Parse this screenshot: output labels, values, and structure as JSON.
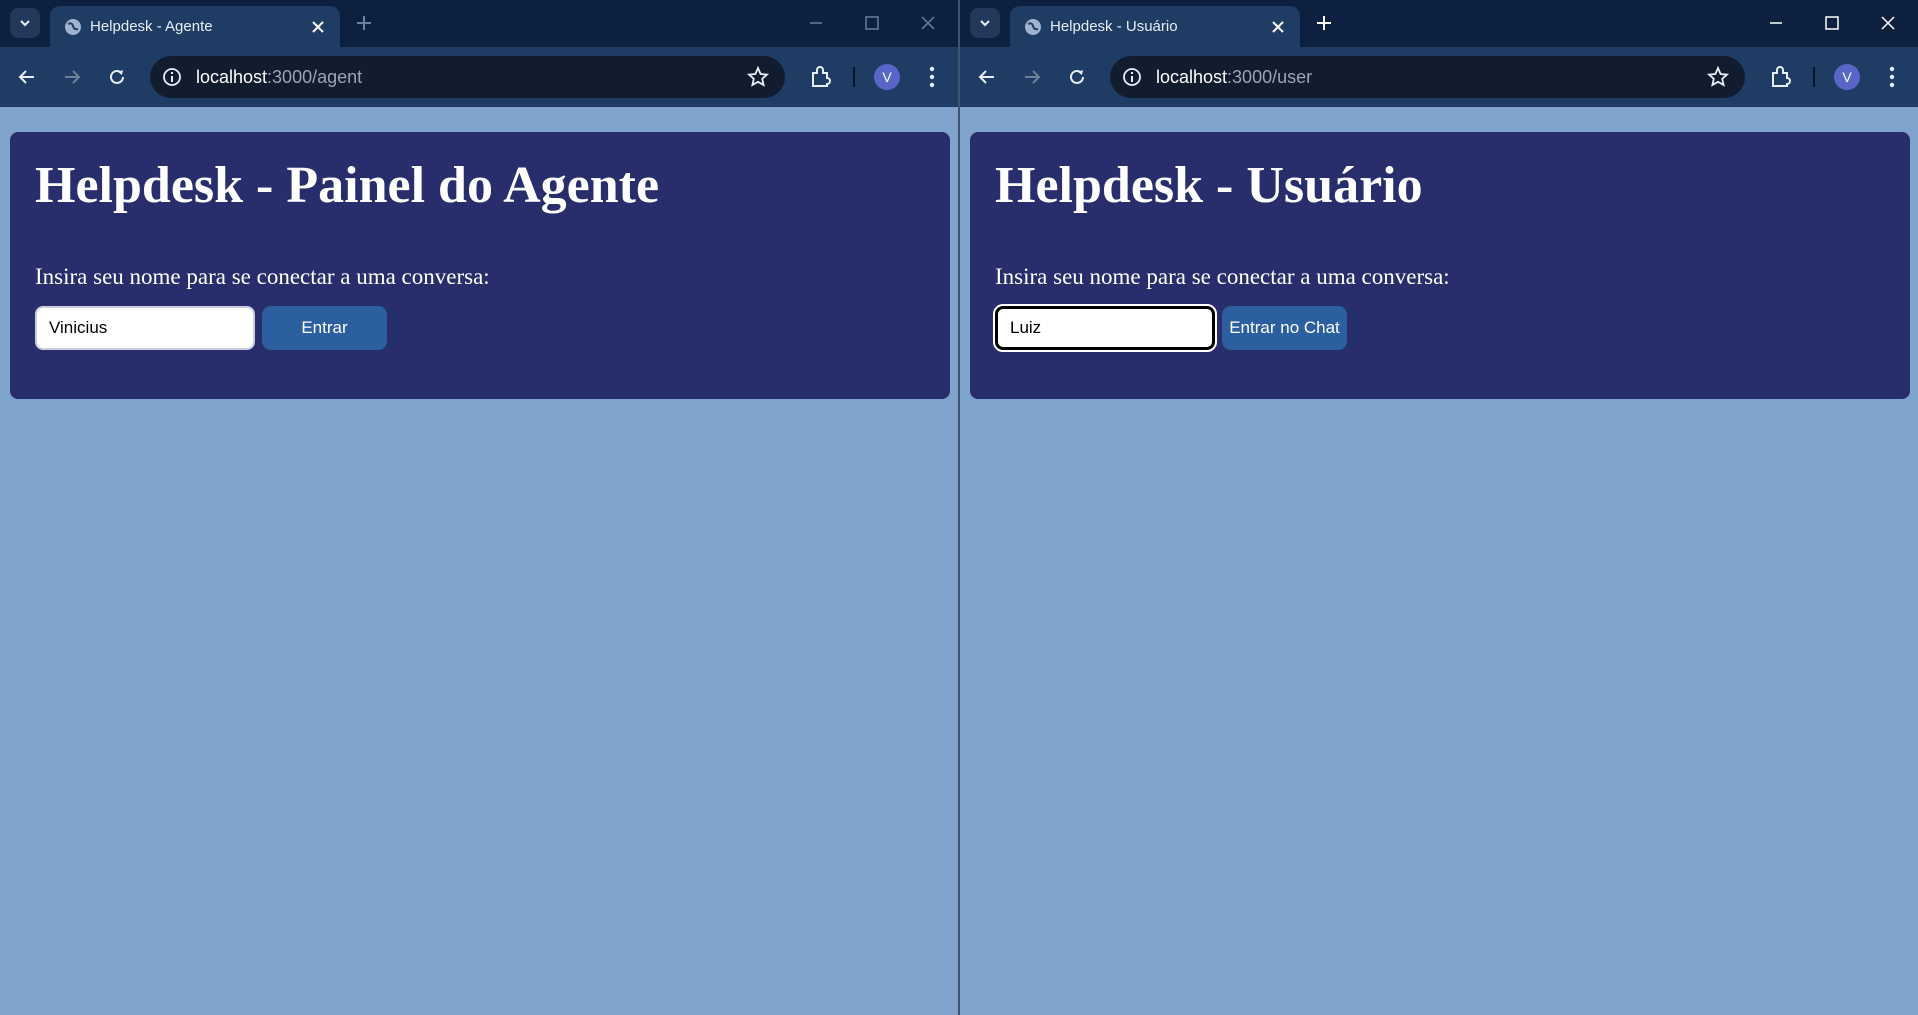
{
  "left_window": {
    "tab_title": "Helpdesk - Agente",
    "url_host": "localhost",
    "url_rest": ":3000/agent",
    "profile_initial": "V",
    "page": {
      "heading": "Helpdesk - Painel do Agente",
      "prompt": "Insira seu nome para se conectar a uma conversa:",
      "name_value": "Vinicius",
      "button_label": "Entrar"
    }
  },
  "right_window": {
    "tab_title": "Helpdesk - Usuário",
    "url_host": "localhost",
    "url_rest": ":3000/user",
    "profile_initial": "V",
    "page": {
      "heading": "Helpdesk - Usuário",
      "prompt": "Insira seu nome para se conectar a uma conversa:",
      "name_value": "Luiz",
      "button_label": "Entrar no Chat"
    }
  },
  "colors": {
    "page_background": "#7fa3cb",
    "card_background": "#282e6c",
    "button_background": "#2b5f9f",
    "tabstrip": "#0d2040",
    "toolbar": "#1e3c64"
  }
}
